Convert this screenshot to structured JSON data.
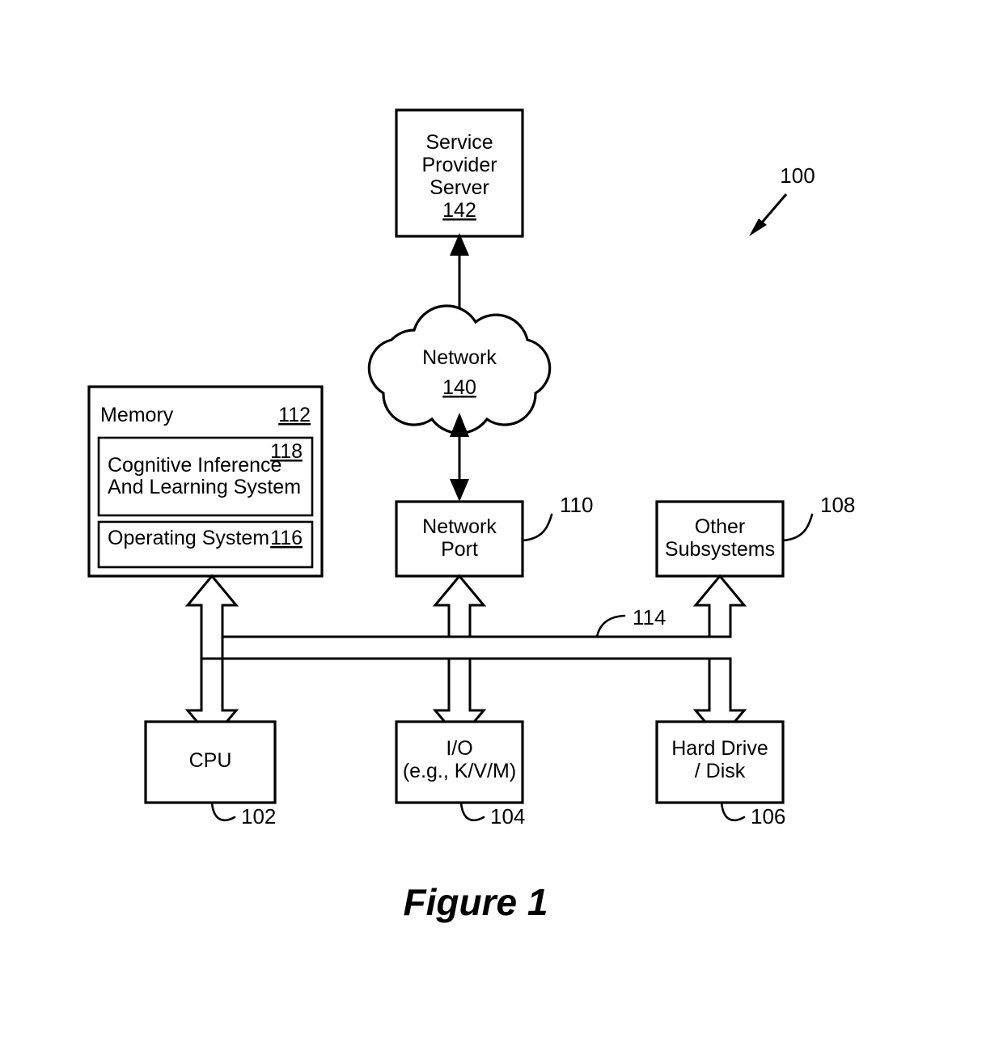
{
  "figure": {
    "caption": "Figure 1",
    "system_ref": "100"
  },
  "nodes": {
    "service_provider_server": {
      "name": "service-provider-server",
      "lines": [
        "Service",
        "Provider",
        "Server"
      ],
      "ref": "142"
    },
    "network_cloud": {
      "name": "network-cloud",
      "label": "Network",
      "ref": "140"
    },
    "memory": {
      "name": "memory-block",
      "label": "Memory",
      "ref": "112",
      "children": [
        {
          "name": "cognitive-inference-and-learning-system",
          "lines": [
            "Cognitive Inference",
            "And Learning System"
          ],
          "ref": "118"
        },
        {
          "name": "operating-system",
          "lines": [
            "Operating System"
          ],
          "ref": "116"
        }
      ]
    },
    "network_port": {
      "name": "network-port",
      "lines": [
        "Network",
        "Port"
      ],
      "ref": "110"
    },
    "other_subsystems": {
      "name": "other-subsystems",
      "lines": [
        "Other",
        "Subsystems"
      ],
      "ref": "108"
    },
    "cpu": {
      "name": "cpu",
      "lines": [
        "CPU"
      ],
      "ref": "102"
    },
    "io": {
      "name": "io-device",
      "lines": [
        "I/O",
        "(e.g., K/V/M)"
      ],
      "ref": "104"
    },
    "hard_drive": {
      "name": "hard-drive-disk",
      "lines": [
        "Hard Drive",
        "/ Disk"
      ],
      "ref": "106"
    },
    "bus": {
      "name": "system-bus",
      "ref": "114"
    }
  },
  "colors": {
    "stroke": "#000000",
    "fill": "#ffffff",
    "background": "#ffffff"
  }
}
